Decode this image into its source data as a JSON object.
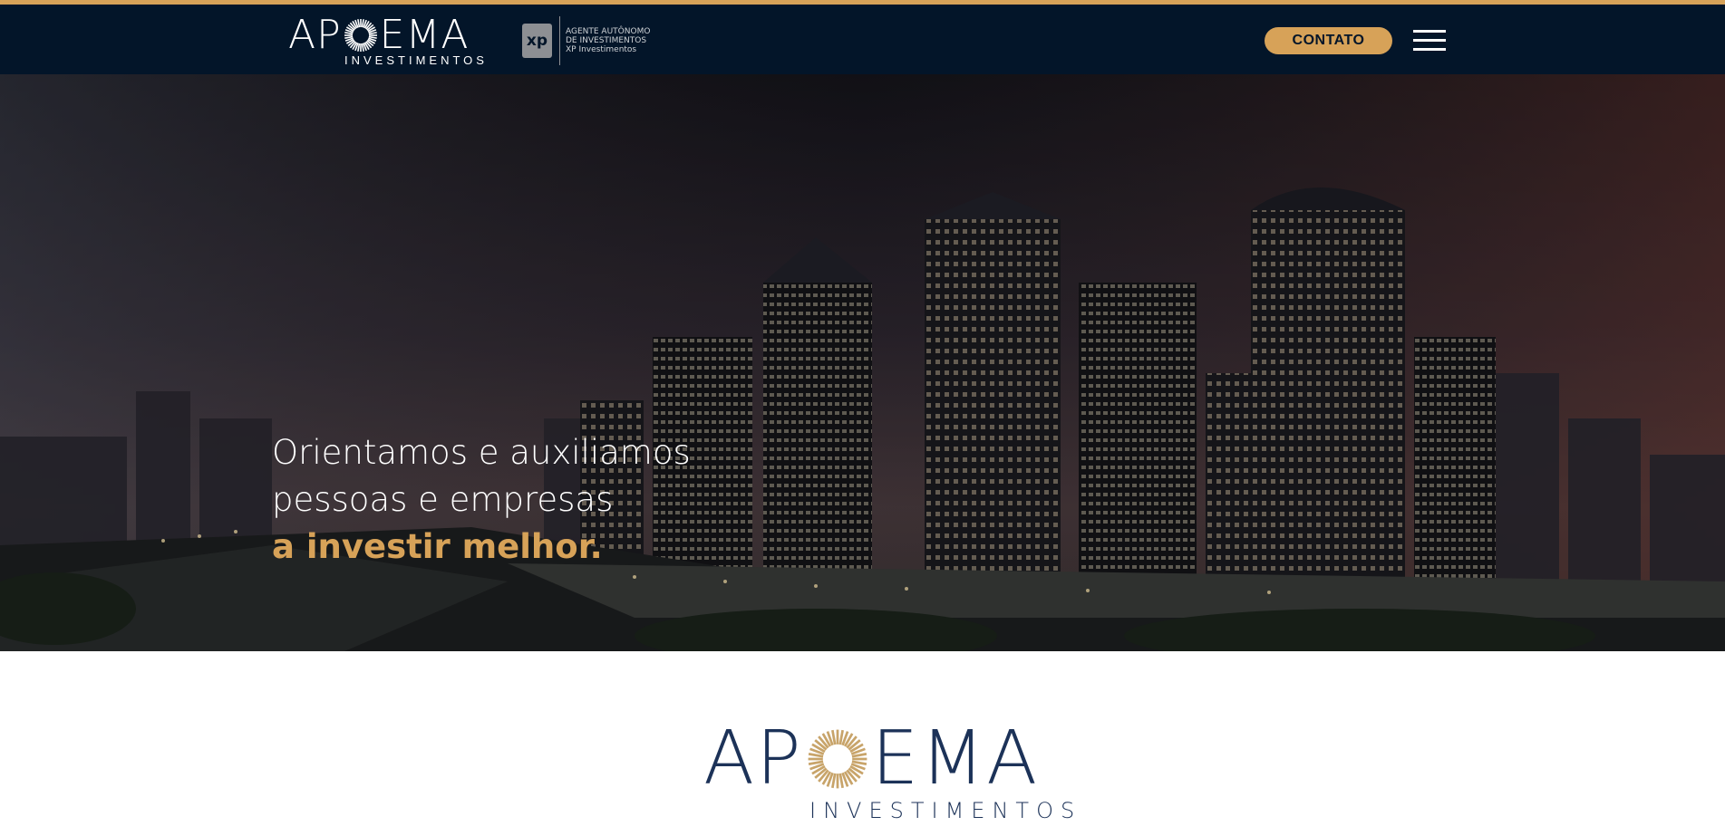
{
  "header": {
    "brand_name": "APOEMA",
    "brand_subtitle": "INVESTIMENTOS",
    "xp_badge_mark": "xp",
    "xp_badge_line1": "AGENTE AUTÔNOMO",
    "xp_badge_line2": "DE INVESTIMENTOS",
    "xp_badge_line3": "XP Investimentos",
    "contact_button": "CONTATO",
    "menu_icon": "hamburger-icon"
  },
  "hero": {
    "line1": "Orientamos e auxiliamos",
    "line2": "pessoas e empresas",
    "accent_line": "a investir melhor."
  },
  "section": {
    "brand_name": "APOEMA",
    "brand_subtitle": "INVESTIMENTOS"
  },
  "colors": {
    "accent": "#d7a258",
    "header_bg": "#031529",
    "brand_navy": "#1c3258"
  }
}
